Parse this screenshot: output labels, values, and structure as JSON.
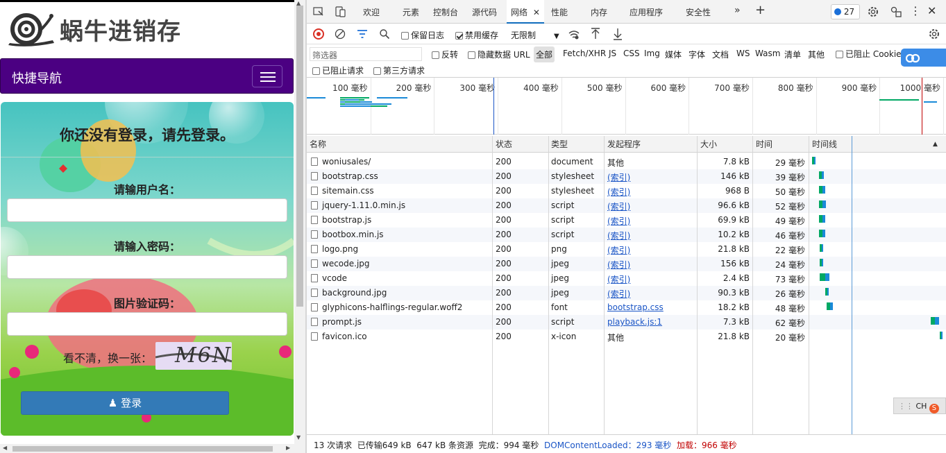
{
  "app": {
    "logo_text": "蜗牛进销存",
    "nav_brand": "快捷导航"
  },
  "login": {
    "heading": "你还没有登录，请先登录。",
    "username_label": "请输用户名：",
    "password_label": "请输入密码：",
    "captcha_label": "图片验证码：",
    "refresh_label": "看不清，换一张：",
    "captcha_text": "M6N",
    "login_button": "登录"
  },
  "devtools": {
    "tabs": [
      "欢迎",
      "元素",
      "控制台",
      "源代码",
      "网络",
      "性能",
      "内存",
      "应用程序",
      "安全性"
    ],
    "active_tab": "网络",
    "issues_count": "27",
    "toolbar": {
      "preserve_log": "保留日志",
      "disable_cache": "禁用缓存",
      "throttle": "无限制"
    },
    "filter": {
      "placeholder": "筛选器",
      "invert": "反转",
      "hide_data_urls": "隐藏数据 URL",
      "types": [
        "全部",
        "Fetch/XHR",
        "JS",
        "CSS",
        "Img",
        "媒体",
        "字体",
        "文档",
        "WS",
        "Wasm",
        "清单",
        "其他"
      ],
      "blocked_cookies": "已阻止 Cookie",
      "blocked_requests": "已阻止请求",
      "third_party": "第三方请求"
    },
    "overview_ticks": [
      "100 毫秒",
      "200 毫秒",
      "300 毫秒",
      "400 毫秒",
      "500 毫秒",
      "600 毫秒",
      "700 毫秒",
      "800 毫秒",
      "900 毫秒",
      "1000 毫秒"
    ],
    "columns": [
      "名称",
      "状态",
      "类型",
      "发起程序",
      "大小",
      "时间",
      "时间线"
    ],
    "requests": [
      {
        "name": "woniusales/",
        "status": "200",
        "type": "document",
        "initiator": "其他",
        "initiator_link": false,
        "size": "7.8 kB",
        "time": "29 毫秒",
        "start": 0.0,
        "dur": 0.029
      },
      {
        "name": "bootstrap.css",
        "status": "200",
        "type": "stylesheet",
        "initiator": "(索引)",
        "initiator_link": true,
        "size": "146 kB",
        "time": "39 毫秒",
        "start": 0.052,
        "dur": 0.039
      },
      {
        "name": "sitemain.css",
        "status": "200",
        "type": "stylesheet",
        "initiator": "(索引)",
        "initiator_link": true,
        "size": "968 B",
        "time": "50 毫秒",
        "start": 0.052,
        "dur": 0.05
      },
      {
        "name": "jquery-1.11.0.min.js",
        "status": "200",
        "type": "script",
        "initiator": "(索引)",
        "initiator_link": true,
        "size": "96.6 kB",
        "time": "52 毫秒",
        "start": 0.052,
        "dur": 0.052
      },
      {
        "name": "bootstrap.js",
        "status": "200",
        "type": "script",
        "initiator": "(索引)",
        "initiator_link": true,
        "size": "69.9 kB",
        "time": "49 毫秒",
        "start": 0.052,
        "dur": 0.049
      },
      {
        "name": "bootbox.min.js",
        "status": "200",
        "type": "script",
        "initiator": "(索引)",
        "initiator_link": true,
        "size": "10.2 kB",
        "time": "46 毫秒",
        "start": 0.052,
        "dur": 0.046
      },
      {
        "name": "logo.png",
        "status": "200",
        "type": "png",
        "initiator": "(索引)",
        "initiator_link": true,
        "size": "21.8 kB",
        "time": "22 毫秒",
        "start": 0.06,
        "dur": 0.022
      },
      {
        "name": "wecode.jpg",
        "status": "200",
        "type": "jpeg",
        "initiator": "(索引)",
        "initiator_link": true,
        "size": "156 kB",
        "time": "24 毫秒",
        "start": 0.06,
        "dur": 0.024
      },
      {
        "name": "vcode",
        "status": "200",
        "type": "jpeg",
        "initiator": "(索引)",
        "initiator_link": true,
        "size": "2.4 kB",
        "time": "73 毫秒",
        "start": 0.06,
        "dur": 0.073
      },
      {
        "name": "background.jpg",
        "status": "200",
        "type": "jpeg",
        "initiator": "(索引)",
        "initiator_link": true,
        "size": "90.3 kB",
        "time": "26 毫秒",
        "start": 0.1,
        "dur": 0.026
      },
      {
        "name": "glyphicons-halflings-regular.woff2",
        "status": "200",
        "type": "font",
        "initiator": "bootstrap.css",
        "initiator_link": true,
        "size": "18.2 kB",
        "time": "48 毫秒",
        "start": 0.11,
        "dur": 0.048
      },
      {
        "name": "prompt.js",
        "status": "200",
        "type": "script",
        "initiator": "playback.js:1",
        "initiator_link": true,
        "size": "7.3 kB",
        "time": "62 毫秒",
        "start": 0.9,
        "dur": 0.062
      },
      {
        "name": "favicon.ico",
        "status": "200",
        "type": "x-icon",
        "initiator": "其他",
        "initiator_link": false,
        "size": "21.8 kB",
        "time": "20 毫秒",
        "start": 0.97,
        "dur": 0.02
      }
    ],
    "status_bar": {
      "requests": "13 次请求",
      "transferred": "已传输649 kB",
      "resources": "647 kB 条资源",
      "finish": "完成：994 毫秒",
      "dcl": "DOMContentLoaded：293 毫秒",
      "load": "加载：966 毫秒"
    },
    "ime_label": "CH",
    "colors": {
      "accent": "#0f6cbd",
      "dcl": "#1a55c6",
      "load": "#c00000",
      "waiting": "#00a864",
      "download": "#1a8ad8"
    }
  }
}
